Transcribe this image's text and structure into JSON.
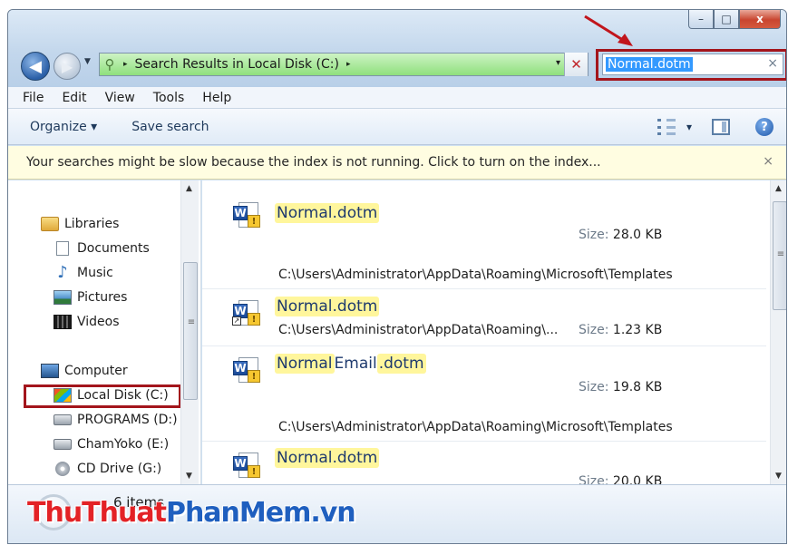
{
  "window": {
    "buttons": {
      "minimize": "–",
      "maximize": "□",
      "close": "x"
    }
  },
  "navigation": {
    "back": "◀",
    "forward": "▶"
  },
  "address": {
    "arrow": "▸",
    "path": "Search Results in Local Disk (C:)",
    "arrow2": "▸",
    "dropdown": "▾",
    "clear": "✕"
  },
  "search": {
    "value": "Normal.dotm",
    "clear": "×"
  },
  "menu": [
    "File",
    "Edit",
    "View",
    "Tools",
    "Help"
  ],
  "toolbar": {
    "organize": "Organize ▾",
    "save_search": "Save search",
    "views_dropdown": "▾",
    "help": "?"
  },
  "infobar": {
    "message": "Your searches might be slow because the index is not running.  Click to turn on the index...",
    "close": "×"
  },
  "nav": {
    "libraries": "Libraries",
    "documents": "Documents",
    "music": "Music",
    "pictures": "Pictures",
    "videos": "Videos",
    "computer": "Computer",
    "local_disk": "Local Disk (C:)",
    "programs": "PROGRAMS (D:)",
    "chamyoko": "ChamYoko (E:)",
    "cd_drive": "CD Drive (G:)"
  },
  "results": [
    {
      "name_hl1": "Normal.dotm",
      "size_label": "Size:",
      "size": "28.0 KB",
      "location": "C:\\Users\\Administrator\\AppData\\Roaming\\Microsoft\\Templates"
    },
    {
      "name_hl1": "Normal.dotm",
      "size_label": "Size:",
      "size": "1.23 KB",
      "location": "C:\\Users\\Administrator\\AppData\\Roaming\\..."
    },
    {
      "name_hl1": "Normal",
      "name_mid": "Email",
      "name_hl2": ".dotm",
      "size_label": "Size:",
      "size": "19.8 KB",
      "location": "C:\\Users\\Administrator\\AppData\\Roaming\\Microsoft\\Templates"
    },
    {
      "name_hl1": "Normal.dotm",
      "size_label": "Size:",
      "size": "20.0 KB"
    }
  ],
  "status": {
    "count": "6 items"
  },
  "watermark": {
    "part1": "ThuThuat",
    "part2": "PhanMem",
    "part3": ".vn"
  },
  "colors": {
    "highlight": "#fff69c",
    "annotation": "#a3151c",
    "address_bar": "#8fe07d"
  }
}
